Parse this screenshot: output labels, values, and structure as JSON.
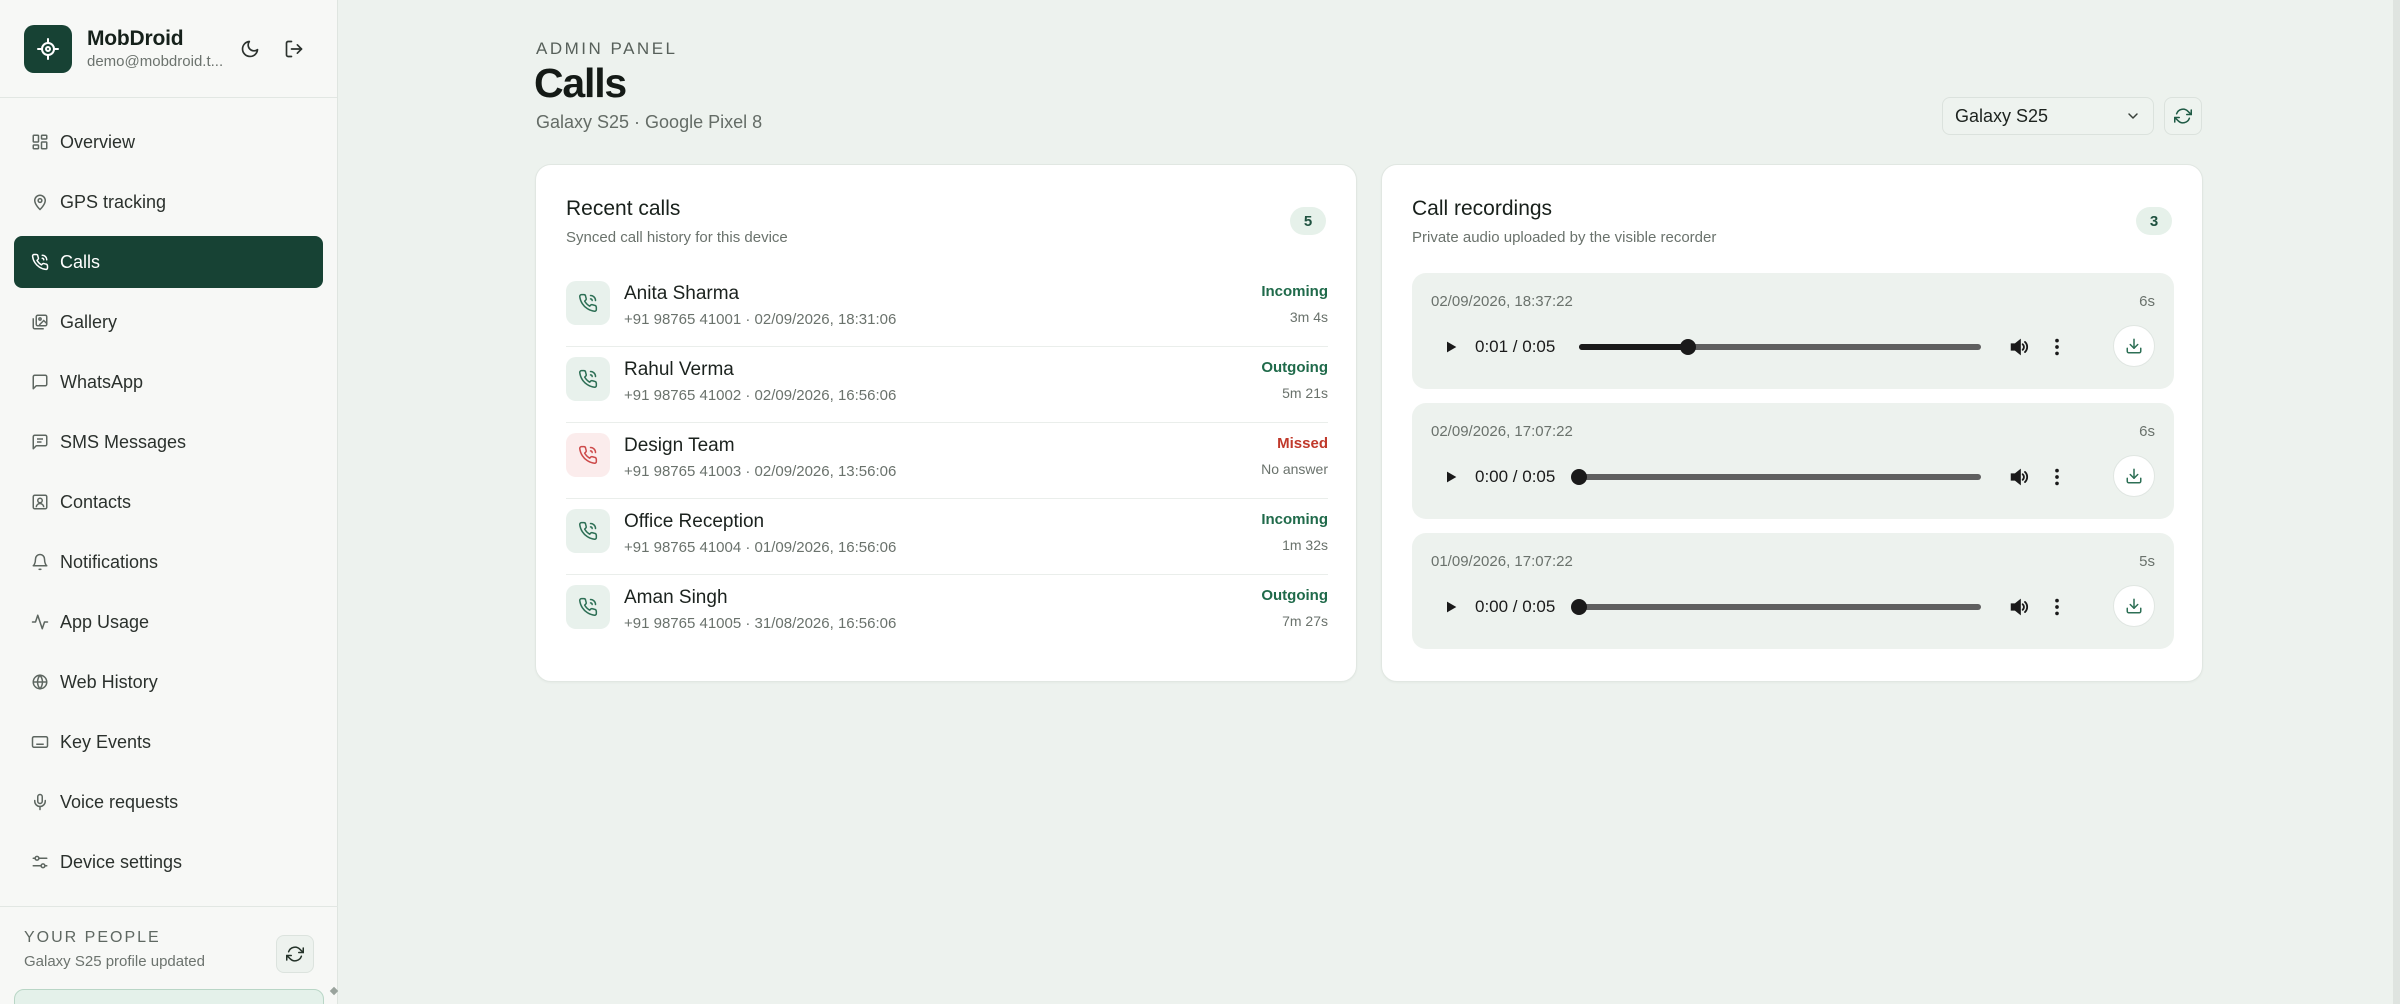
{
  "brand": {
    "name": "MobDroid",
    "email": "demo@mobdroid.t..."
  },
  "sidebar": {
    "items": [
      {
        "label": "Overview",
        "icon": "grid-icon"
      },
      {
        "label": "GPS tracking",
        "icon": "map-pin-icon"
      },
      {
        "label": "Calls",
        "icon": "phone-icon",
        "active": true
      },
      {
        "label": "Gallery",
        "icon": "image-icon"
      },
      {
        "label": "WhatsApp",
        "icon": "chat-icon"
      },
      {
        "label": "SMS Messages",
        "icon": "message-icon"
      },
      {
        "label": "Contacts",
        "icon": "contacts-icon"
      },
      {
        "label": "Notifications",
        "icon": "bell-icon"
      },
      {
        "label": "App Usage",
        "icon": "activity-icon"
      },
      {
        "label": "Web History",
        "icon": "globe-icon"
      },
      {
        "label": "Key Events",
        "icon": "keyboard-icon"
      },
      {
        "label": "Voice requests",
        "icon": "microphone-icon"
      },
      {
        "label": "Device settings",
        "icon": "settings-sliders-icon"
      }
    ]
  },
  "people": {
    "title": "YOUR PEOPLE",
    "subtitle": "Galaxy S25 profile updated"
  },
  "header": {
    "eyebrow": "ADMIN PANEL",
    "title": "Calls",
    "subtitle": "Galaxy S25 · Google Pixel 8",
    "device_selected": "Galaxy S25"
  },
  "recent_calls": {
    "title": "Recent calls",
    "subtitle": "Synced call history for this device",
    "count": "5",
    "rows": [
      {
        "name": "Anita Sharma",
        "meta": "+91 98765 41001 · 02/09/2026, 18:31:06",
        "type": "Incoming",
        "duration": "3m 4s",
        "missed": false
      },
      {
        "name": "Rahul Verma",
        "meta": "+91 98765 41002 · 02/09/2026, 16:56:06",
        "type": "Outgoing",
        "duration": "5m 21s",
        "missed": false
      },
      {
        "name": "Design Team",
        "meta": "+91 98765 41003 · 02/09/2026, 13:56:06",
        "type": "Missed",
        "duration": "No answer",
        "missed": true
      },
      {
        "name": "Office Reception",
        "meta": "+91 98765 41004 · 01/09/2026, 16:56:06",
        "type": "Incoming",
        "duration": "1m 32s",
        "missed": false
      },
      {
        "name": "Aman Singh",
        "meta": "+91 98765 41005 · 31/08/2026, 16:56:06",
        "type": "Outgoing",
        "duration": "7m 27s",
        "missed": false
      }
    ]
  },
  "recordings": {
    "title": "Call recordings",
    "subtitle": "Private audio uploaded by the visible recorder",
    "count": "3",
    "items": [
      {
        "date": "02/09/2026, 18:37:22",
        "length": "6s",
        "time": "0:01 / 0:05",
        "progress": 0.27
      },
      {
        "date": "02/09/2026, 17:07:22",
        "length": "6s",
        "time": "0:00 / 0:05",
        "progress": 0
      },
      {
        "date": "01/09/2026, 17:07:22",
        "length": "5s",
        "time": "0:00 / 0:05",
        "progress": 0
      }
    ]
  },
  "colors": {
    "accent": "#174234",
    "background": "#edf2ee",
    "incoming": "#1f6a4a",
    "missed": "#c0392b"
  }
}
